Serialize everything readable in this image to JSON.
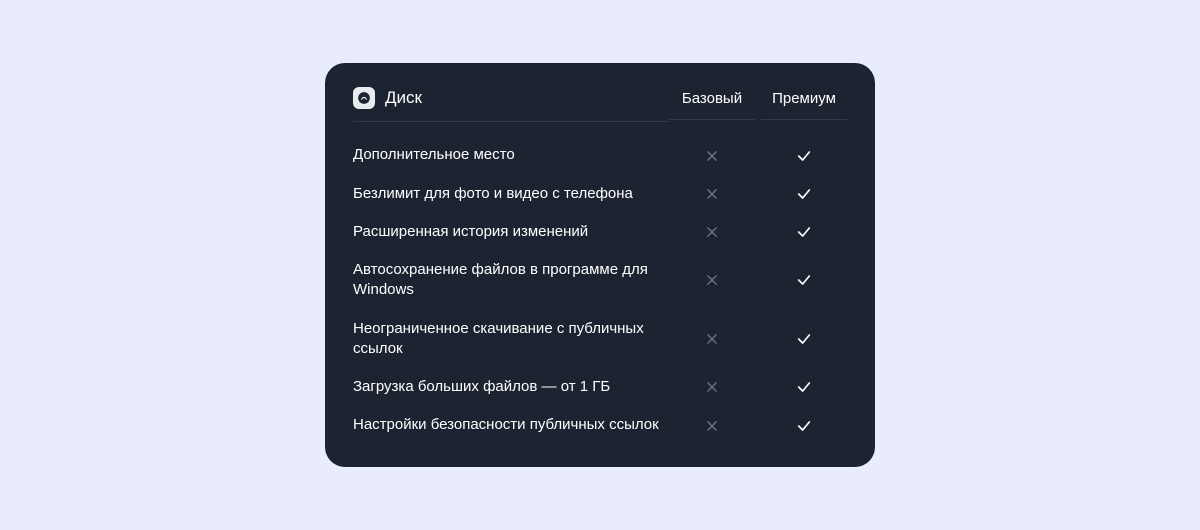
{
  "card": {
    "title": "Диск",
    "plans": [
      "Базовый",
      "Премиум"
    ],
    "features": [
      {
        "label": "Дополнительное место",
        "basic": false,
        "premium": true
      },
      {
        "label": "Безлимит для фото и видео с телефона",
        "basic": false,
        "premium": true
      },
      {
        "label": "Расширенная история изменений",
        "basic": false,
        "premium": true
      },
      {
        "label": "Автосохранение файлов в программе для Windows",
        "basic": false,
        "premium": true
      },
      {
        "label": "Неограниченное скачивание с публичных ссылок",
        "basic": false,
        "premium": true
      },
      {
        "label": "Загрузка больших файлов — от 1 ГБ",
        "basic": false,
        "premium": true
      },
      {
        "label": "Настройки безопасности публичных ссылок",
        "basic": false,
        "premium": true
      }
    ]
  },
  "colors": {
    "cross": "#6b7280",
    "check": "#ffffff"
  }
}
